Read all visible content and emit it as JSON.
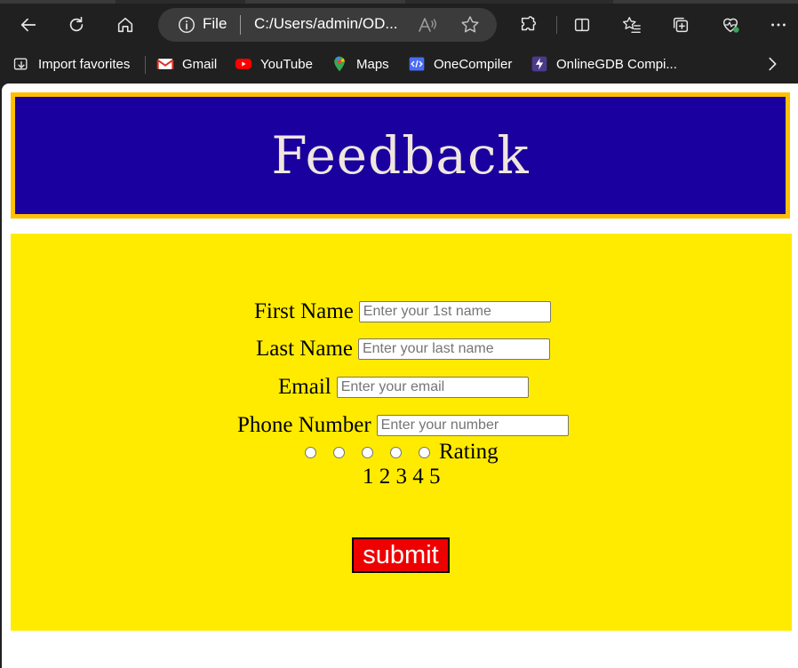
{
  "browser": {
    "address": {
      "scheme_label": "File",
      "url": "C:/Users/admin/OD..."
    },
    "bookmarks": [
      {
        "label": "Import favorites",
        "icon": "import-icon"
      },
      {
        "label": "Gmail",
        "icon": "gmail-icon"
      },
      {
        "label": "YouTube",
        "icon": "youtube-icon"
      },
      {
        "label": "Maps",
        "icon": "maps-icon"
      },
      {
        "label": "OneCompiler",
        "icon": "onecompiler-icon"
      },
      {
        "label": "OnlineGDB Compi...",
        "icon": "onlinegdb-icon"
      }
    ],
    "colors": {
      "chrome_bg": "#202020",
      "address_bg": "#3b3b3b"
    }
  },
  "page": {
    "title": "Feedback",
    "fields": [
      {
        "label": "First Name",
        "placeholder": "Enter your 1st name"
      },
      {
        "label": "Last Name",
        "placeholder": "Enter your last name"
      },
      {
        "label": "Email",
        "placeholder": "Enter your email"
      },
      {
        "label": "Phone Number",
        "placeholder": "Enter your number"
      }
    ],
    "rating": {
      "label": "Rating",
      "numbers": "1 2 3 4 5"
    },
    "submit_label": "submit",
    "colors": {
      "header_bg": "#1a009e",
      "header_border": "#ffc000",
      "header_text": "#f0e6de",
      "form_bg": "#ffeb00",
      "submit_bg": "#ee0000"
    }
  }
}
